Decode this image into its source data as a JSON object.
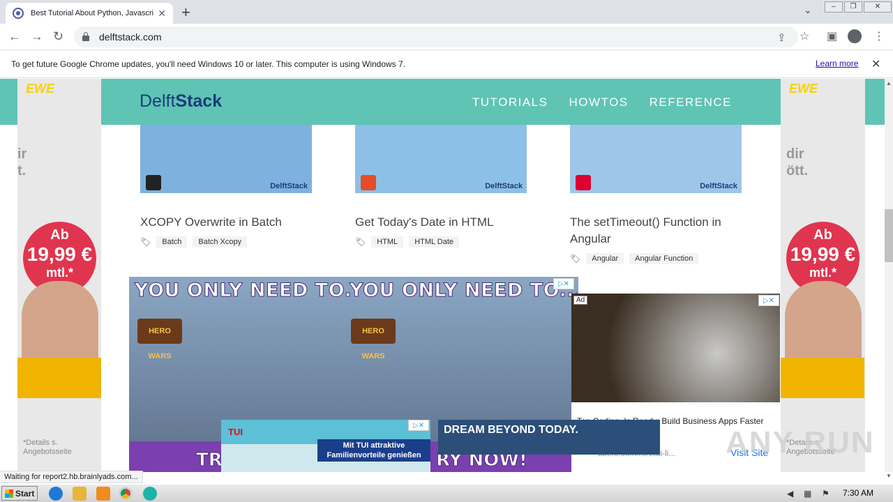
{
  "browser": {
    "tab_title": "Best Tutorial About Python, Javascri",
    "tab_close": "✕",
    "new_tab": "+",
    "tab_search": "⌄",
    "url": "delftstack.com",
    "window_controls": [
      "–",
      "❐",
      "✕"
    ]
  },
  "infobar": {
    "message": "To get future Google Chrome updates, you'll need Windows 10 or later. This computer is using Windows 7.",
    "learn_more": "Learn more",
    "close": "✕"
  },
  "site": {
    "logo_light": "Delft",
    "logo_bold": "Stack",
    "nav": [
      "TUTORIALS",
      "HOWTOS",
      "REFERENCE"
    ]
  },
  "articles": [
    {
      "title": "XCOPY Overwrite in Batch",
      "tags": [
        "Batch",
        "Batch Xcopy"
      ],
      "thumb_color": "#8fb8e0",
      "badge": "DelftStack"
    },
    {
      "title": "Get Today's Date in HTML",
      "tags": [
        "HTML",
        "HTML Date"
      ],
      "thumb_color": "#8fb8e0",
      "badge": "DelftStack"
    },
    {
      "title": "The setTimeout() Function in Angular",
      "tags": [
        "Angular",
        "Angular Function"
      ],
      "thumb_color": "#8fb8e0",
      "badge": "DelftStack"
    }
  ],
  "side_ad": {
    "brand": "EWE",
    "tagline_left": "ir\nt.",
    "tagline_right": "dir\nött.",
    "price_prefix": "Ab",
    "price": "19,99 €",
    "price_suffix": "mtl.*",
    "details": "*Details s.\nAngebotsseite"
  },
  "ad_herowars": {
    "headline": "YOU ONLY NEED TO.",
    "headline_2": "YOU ONLY NEED TO...",
    "logo": "HERO WARS",
    "cta_left": "TR",
    "cta_right": "RY NOW!"
  },
  "ad_grinder": {
    "ad_label": "Ad",
    "headline": "Top Coding, Is Ready: Build Business Apps Faster",
    "domain": "talent.com/re/etui-li...",
    "cta": "Visit Site"
  },
  "ad_tui": {
    "logo": "TUI",
    "text": "Mit TUI attraktive Familienvorteile genießen"
  },
  "ad_dream": {
    "text": "DREAM BEYOND TODAY."
  },
  "status": "Waiting for report2.hb.brainlyads.com...",
  "watermark": "ANY RUN",
  "taskbar": {
    "start": "Start",
    "time": "7:30 AM"
  }
}
